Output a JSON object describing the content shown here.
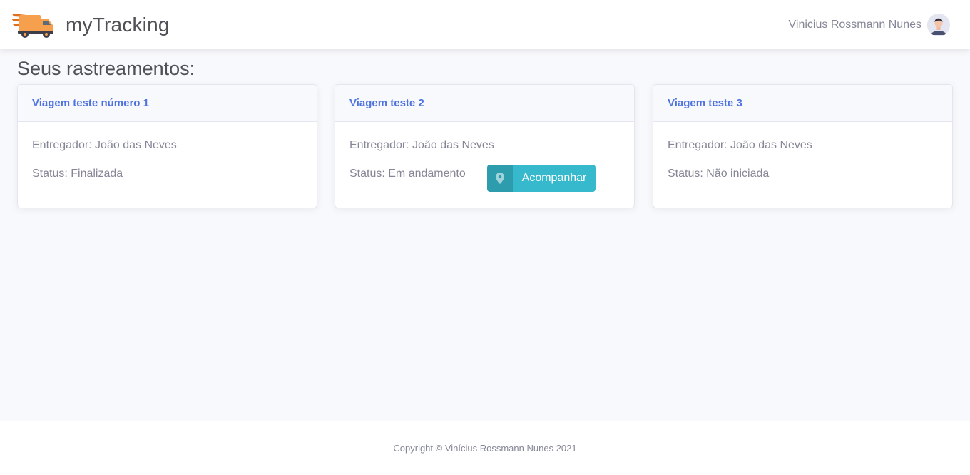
{
  "header": {
    "brand_name": "myTracking",
    "user_name": "Vinicius Rossmann Nunes"
  },
  "main": {
    "page_title": "Seus rastreamentos:",
    "cards": [
      {
        "title": "Viagem teste número 1",
        "courier": "Entregador: João das Neves",
        "status": "Status: Finalizada"
      },
      {
        "title": "Viagem teste 2",
        "courier": "Entregador: João das Neves",
        "status": "Status: Em andamento",
        "action_label": "Acompanhar",
        "action_icon": "map-marker-icon"
      },
      {
        "title": "Viagem teste 3",
        "courier": "Entregador: João das Neves",
        "status": "Status: Não iniciada"
      }
    ]
  },
  "footer": {
    "copyright": "Copyright © Vinícius Rossmann Nunes 2021"
  },
  "colors": {
    "primary": "#4e73df",
    "info": "#36b9cc",
    "text": "#858796",
    "background": "#f8f9fc",
    "logo_truck": "#f6a04d"
  }
}
